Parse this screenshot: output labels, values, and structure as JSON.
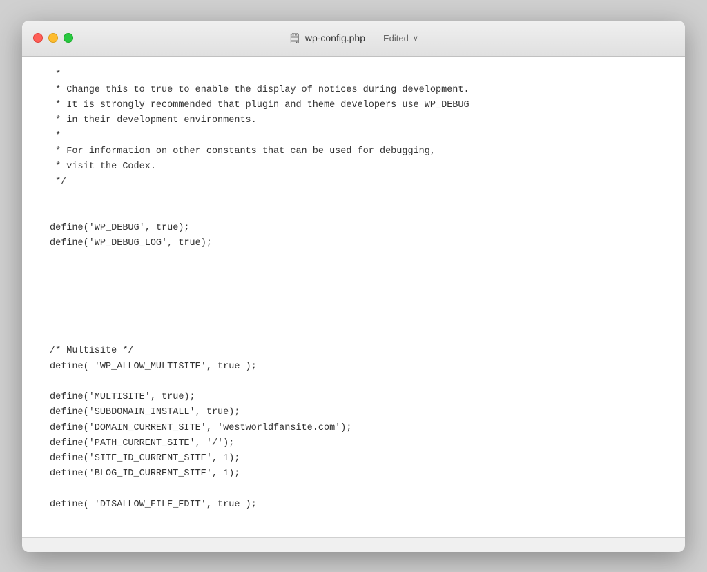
{
  "titlebar": {
    "filename": "wp-config.php",
    "separator": "—",
    "edited_label": "Edited",
    "chevron": "∨",
    "file_icon": "📄"
  },
  "traffic_lights": {
    "close_label": "close",
    "minimize_label": "minimize",
    "maximize_label": "maximize"
  },
  "code": {
    "lines": [
      " *",
      " * Change this to true to enable the display of notices during development.",
      " * It is strongly recommended that plugin and theme developers use WP_DEBUG",
      " * in their development environments.",
      " *",
      " * For information on other constants that can be used for debugging,",
      " * visit the Codex.",
      " */",
      "",
      "",
      "define('WP_DEBUG', true);",
      "define('WP_DEBUG_LOG', true);",
      "",
      "",
      "",
      "",
      "",
      "",
      "/* Multisite */",
      "define( 'WP_ALLOW_MULTISITE', true );",
      "",
      "define('MULTISITE', true);",
      "define('SUBDOMAIN_INSTALL', true);",
      "define('DOMAIN_CURRENT_SITE', 'westworldfansite.com');",
      "define('PATH_CURRENT_SITE', '/');",
      "define('SITE_ID_CURRENT_SITE', 1);",
      "define('BLOG_ID_CURRENT_SITE', 1);",
      "",
      "define( 'DISALLOW_FILE_EDIT', true );"
    ]
  }
}
